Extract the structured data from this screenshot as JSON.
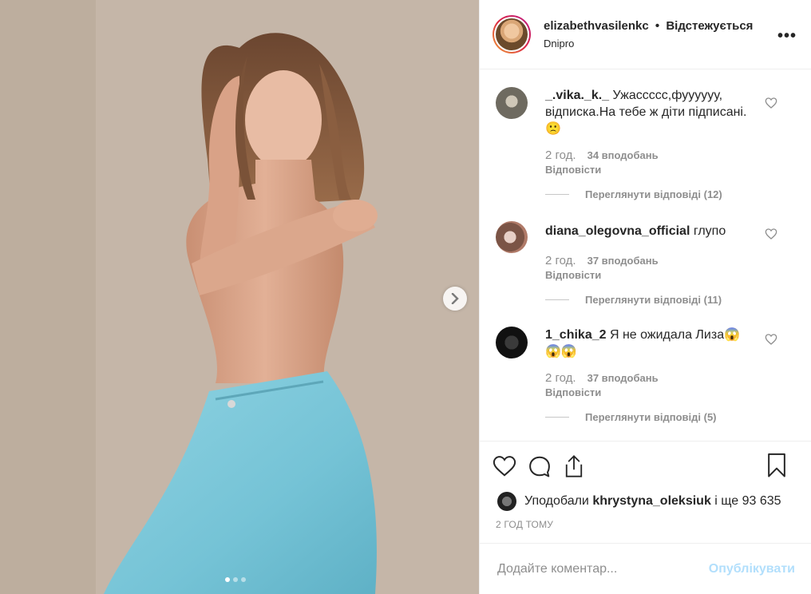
{
  "header": {
    "username": "elizabethvasilenkc",
    "separator": "•",
    "follow_status": "Відстежується",
    "location": "Dnipro",
    "more_label": "•••"
  },
  "media": {
    "carousel_dots": 3,
    "active_dot": 1
  },
  "comments": [
    {
      "username": "_.vika._k._",
      "text": "Ужассссс,фуууууу, відписка.На тебе ж діти підписані.🙁",
      "time": "2 год.",
      "likes": "34 вподобань",
      "reply": "Відповісти",
      "view_replies": "Переглянути відповіді (12)",
      "avatar_color": "#8a8578"
    },
    {
      "username": "diana_olegovna_official",
      "text": "глупо",
      "time": "2 год.",
      "likes": "37 вподобань",
      "reply": "Відповісти",
      "view_replies": "Переглянути відповіді (11)",
      "avatar_color": "#6f4a3a"
    },
    {
      "username": "1_chika_2",
      "text": "Я не ожидала Лиза😱 😱😱",
      "time": "2 год.",
      "likes": "37 вподобань",
      "reply": "Відповісти",
      "view_replies": "Переглянути відповіді (5)",
      "avatar_color": "#1e1e1e"
    }
  ],
  "likes": {
    "prefix": "Уподобали",
    "user": "khrystyna_oleksiuk",
    "suffix": "і ще 93 635"
  },
  "post_time": "2 ГОД ТОМУ",
  "add_comment": {
    "placeholder": "Додайте коментар...",
    "publish_label": "Опублікувати"
  },
  "colors": {
    "publish_disabled": "#b2dffc",
    "secondary_text": "#8e8e8e",
    "primary_text": "#262626"
  }
}
